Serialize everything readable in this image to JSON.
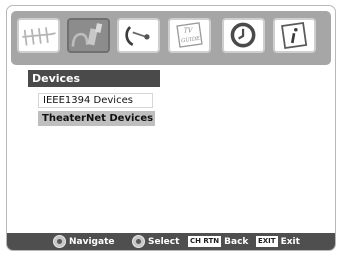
{
  "menu_icons": [
    {
      "name": "antenna-icon",
      "selected": false
    },
    {
      "name": "connector-icon",
      "selected": true
    },
    {
      "name": "satellite-dish-icon",
      "selected": false
    },
    {
      "name": "tv-guide-icon",
      "selected": false,
      "label_top": "TV",
      "label_bottom": "GUIDE"
    },
    {
      "name": "clock-icon",
      "selected": false
    },
    {
      "name": "info-icon",
      "selected": false
    }
  ],
  "section": {
    "title": "Devices"
  },
  "items": [
    {
      "label": "IEEE1394 Devices"
    },
    {
      "label": "TheaterNet Devices"
    }
  ],
  "footer": {
    "navigate": "Navigate",
    "select": "Select",
    "ch_rtn_key": "CH RTN",
    "back": "Back",
    "exit_key": "EXIT",
    "exit": "Exit"
  },
  "colors": {
    "icon_bar": "#a6a6a6",
    "header": "#4a4a4a",
    "focused_item": "#bfbfbf",
    "footer": "#4f4f4f"
  }
}
